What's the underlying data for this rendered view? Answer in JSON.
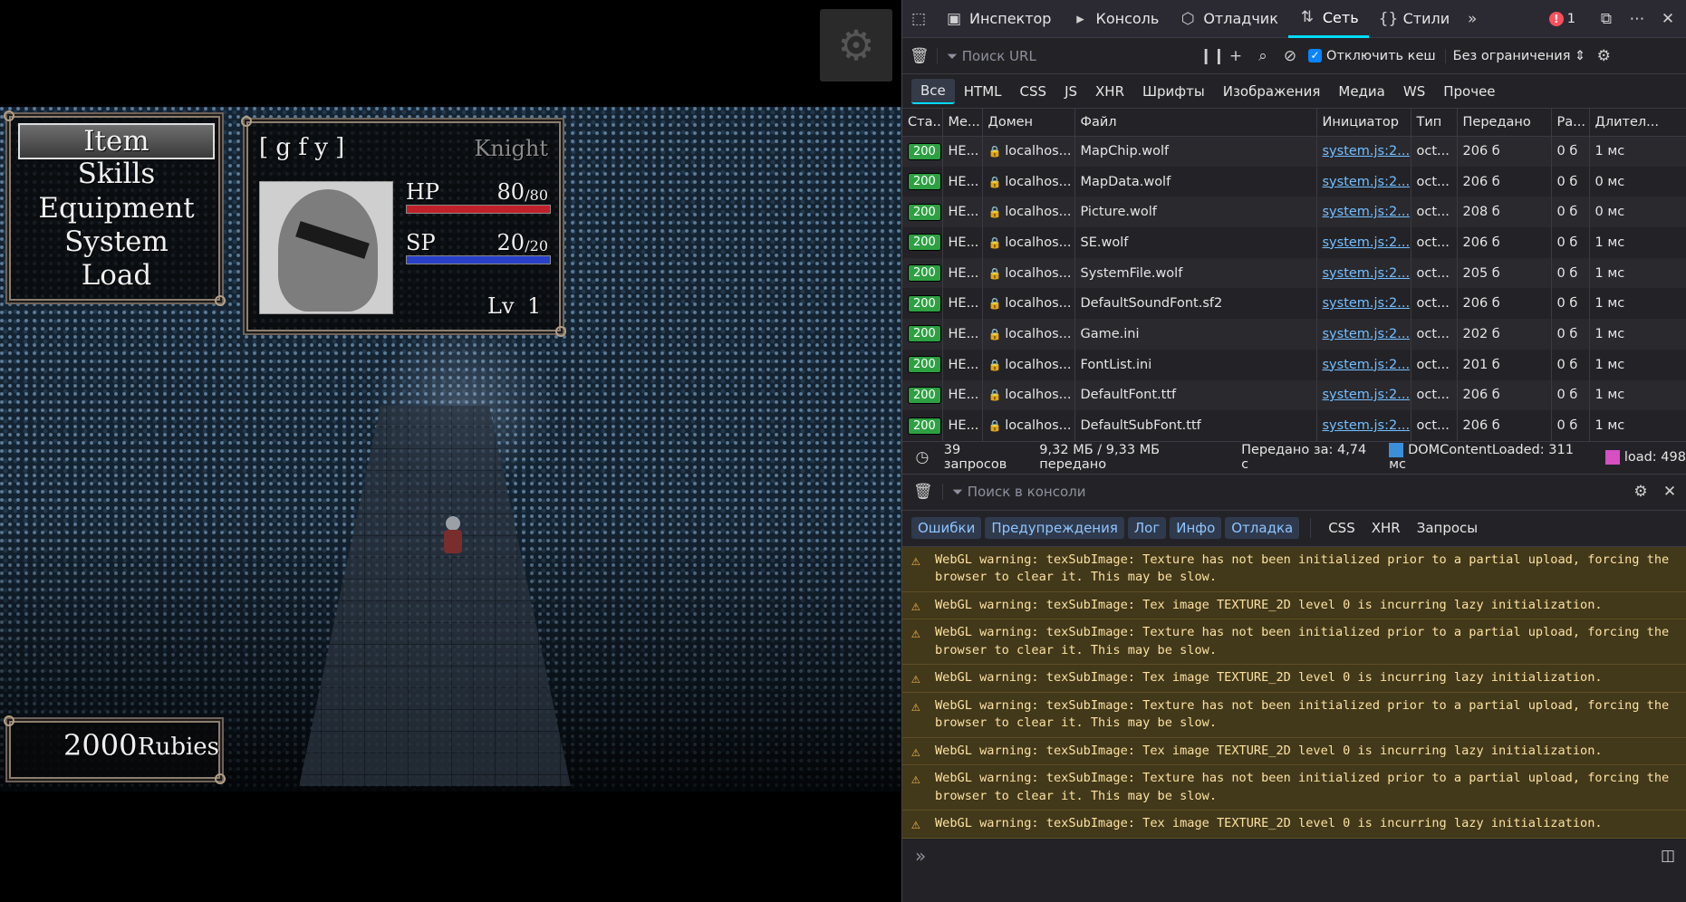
{
  "game": {
    "menu": [
      "Item",
      "Skills",
      "Equipment",
      "System",
      "Load"
    ],
    "actor": {
      "name": "[ g f y ]",
      "class": "Knight",
      "hp_label": "HP",
      "hp_current": "80",
      "hp_max": "/80",
      "hp_ratio": 1.0,
      "sp_label": "SP",
      "sp_current": "20",
      "sp_max": "/20",
      "sp_ratio": 1.0,
      "level_label": "Lv",
      "level": "1"
    },
    "gold": {
      "amount": "2000",
      "unit": "Rubies"
    },
    "colors": {
      "hp": "#c0202a",
      "sp": "#2840c8"
    }
  },
  "devtools": {
    "tabs": [
      {
        "label": "Инспектор",
        "icon": "inspector-icon"
      },
      {
        "label": "Консоль",
        "icon": "console-icon"
      },
      {
        "label": "Отладчик",
        "icon": "debugger-icon"
      },
      {
        "label": "Сеть",
        "icon": "network-icon"
      },
      {
        "label": "Стили",
        "icon": "styles-icon"
      }
    ],
    "error_count": "1",
    "network": {
      "url_filter_placeholder": "Поиск URL",
      "disable_cache": "Отключить кеш",
      "throttle": "Без ограничения",
      "type_filters": [
        "Все",
        "HTML",
        "CSS",
        "JS",
        "XHR",
        "Шрифты",
        "Изображения",
        "Медиа",
        "WS",
        "Прочее"
      ],
      "columns": [
        "Ста...",
        "Ме...",
        "Домен",
        "Файл",
        "Инициатор",
        "Тип",
        "Передано",
        "Ра...",
        "Длител..."
      ],
      "rows": [
        {
          "status": "200",
          "method": "HE...",
          "domain": "localhos...",
          "file": "MapChip.wolf",
          "initiator": "system.js:2...",
          "type": "oct...",
          "transferred": "206 б",
          "size": "0 б",
          "duration": "1 мс"
        },
        {
          "status": "200",
          "method": "HE...",
          "domain": "localhos...",
          "file": "MapData.wolf",
          "initiator": "system.js:2...",
          "type": "oct...",
          "transferred": "206 б",
          "size": "0 б",
          "duration": "0 мс"
        },
        {
          "status": "200",
          "method": "HE...",
          "domain": "localhos...",
          "file": "Picture.wolf",
          "initiator": "system.js:2...",
          "type": "oct...",
          "transferred": "208 б",
          "size": "0 б",
          "duration": "0 мс"
        },
        {
          "status": "200",
          "method": "HE...",
          "domain": "localhos...",
          "file": "SE.wolf",
          "initiator": "system.js:2...",
          "type": "oct...",
          "transferred": "206 б",
          "size": "0 б",
          "duration": "1 мс"
        },
        {
          "status": "200",
          "method": "HE...",
          "domain": "localhos...",
          "file": "SystemFile.wolf",
          "initiator": "system.js:2...",
          "type": "oct...",
          "transferred": "205 б",
          "size": "0 б",
          "duration": "1 мс"
        },
        {
          "status": "200",
          "method": "HE...",
          "domain": "localhos...",
          "file": "DefaultSoundFont.sf2",
          "initiator": "system.js:2...",
          "type": "oct...",
          "transferred": "206 б",
          "size": "0 б",
          "duration": "1 мс"
        },
        {
          "status": "200",
          "method": "HE...",
          "domain": "localhos...",
          "file": "Game.ini",
          "initiator": "system.js:2...",
          "type": "oct...",
          "transferred": "202 б",
          "size": "0 б",
          "duration": "1 мс"
        },
        {
          "status": "200",
          "method": "HE...",
          "domain": "localhos...",
          "file": "FontList.ini",
          "initiator": "system.js:2...",
          "type": "oct...",
          "transferred": "201 б",
          "size": "0 б",
          "duration": "1 мс"
        },
        {
          "status": "200",
          "method": "HE...",
          "domain": "localhos...",
          "file": "DefaultFont.ttf",
          "initiator": "system.js:2...",
          "type": "oct...",
          "transferred": "206 б",
          "size": "0 б",
          "duration": "1 мс"
        },
        {
          "status": "200",
          "method": "HE...",
          "domain": "localhos...",
          "file": "DefaultSubFont.ttf",
          "initiator": "system.js:2...",
          "type": "oct...",
          "transferred": "206 б",
          "size": "0 б",
          "duration": "1 мс"
        }
      ],
      "summary": {
        "requests": "39 запросов",
        "transferred": "9,32 МБ / 9,33 МБ передано",
        "finish": "Передано за: 4,74 с",
        "dcl": "DOMContentLoaded: 311 мс",
        "load": "load: 498"
      }
    },
    "console": {
      "filter_placeholder": "Поиск в консоли",
      "levels": [
        "Ошибки",
        "Предупреждения",
        "Лог",
        "Инфо",
        "Отладка"
      ],
      "types": [
        "CSS",
        "XHR",
        "Запросы"
      ],
      "messages": [
        "WebGL warning: texSubImage: Texture has not been initialized prior to a partial upload, forcing the browser to clear it. This may be slow.",
        "WebGL warning: texSubImage: Tex image TEXTURE_2D level 0 is incurring lazy initialization.",
        "WebGL warning: texSubImage: Texture has not been initialized prior to a partial upload, forcing the browser to clear it. This may be slow.",
        "WebGL warning: texSubImage: Tex image TEXTURE_2D level 0 is incurring lazy initialization.",
        "WebGL warning: texSubImage: Texture has not been initialized prior to a partial upload, forcing the browser to clear it. This may be slow.",
        "WebGL warning: texSubImage: Tex image TEXTURE_2D level 0 is incurring lazy initialization.",
        "WebGL warning: texSubImage: Texture has not been initialized prior to a partial upload, forcing the browser to clear it. This may be slow.",
        "WebGL warning: texSubImage: Tex image TEXTURE_2D level 0 is incurring lazy initialization."
      ],
      "prompt": "»"
    }
  }
}
